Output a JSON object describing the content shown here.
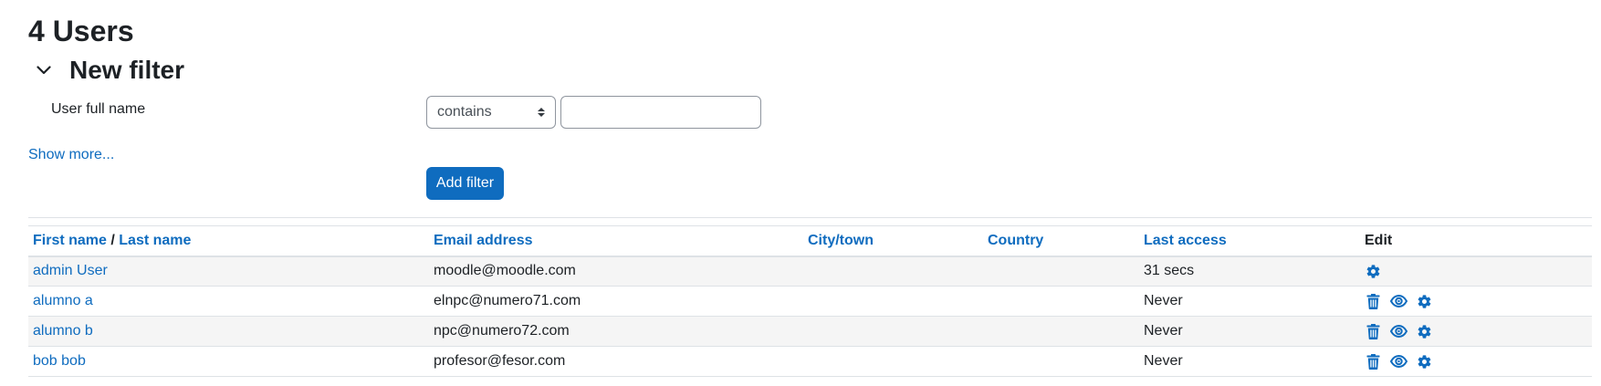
{
  "page": {
    "heading": "4 Users"
  },
  "filter": {
    "section_title": "New filter",
    "field_label": "User full name",
    "operator_selected": "contains",
    "value": "",
    "show_more": "Show more...",
    "add_filter_label": "Add filter"
  },
  "table": {
    "headers": {
      "first_name": "First name",
      "name_separator": " / ",
      "last_name": "Last name",
      "email": "Email address",
      "city": "City/town",
      "country": "Country",
      "last_access": "Last access",
      "edit": "Edit"
    },
    "rows": [
      {
        "name": "admin User",
        "email": "moodle@moodle.com",
        "city": "",
        "country": "",
        "last_access": "31 secs",
        "actions": [
          "settings-icon"
        ]
      },
      {
        "name": "alumno a",
        "email": "elnpc@numero71.com",
        "city": "",
        "country": "",
        "last_access": "Never",
        "actions": [
          "trash-icon",
          "eye-icon",
          "settings-icon"
        ]
      },
      {
        "name": "alumno b",
        "email": "npc@numero72.com",
        "city": "",
        "country": "",
        "last_access": "Never",
        "actions": [
          "trash-icon",
          "eye-icon",
          "settings-icon"
        ]
      },
      {
        "name": "bob bob",
        "email": "profesor@fesor.com",
        "city": "",
        "country": "",
        "last_access": "Never",
        "actions": [
          "trash-icon",
          "eye-icon",
          "settings-icon"
        ]
      }
    ]
  },
  "colors": {
    "link": "#0f6cbf",
    "primary_button": "#0f6cbf",
    "text": "#1d2125",
    "row_stripe": "#f5f5f5",
    "border": "#dee2e6"
  }
}
